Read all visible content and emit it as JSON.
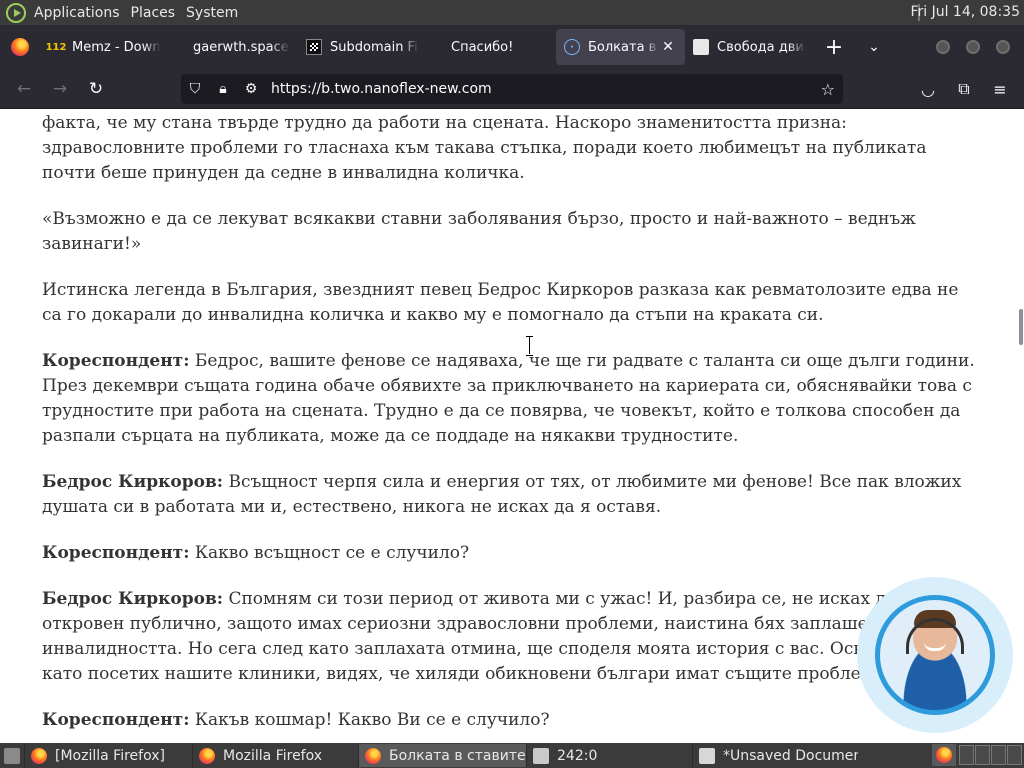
{
  "panel": {
    "menus": [
      "Applications",
      "Places",
      "System"
    ],
    "clock": "Fri Jul 14, 08:35"
  },
  "tabs": [
    {
      "label": "Memz - Down",
      "favicon": "memz-icon",
      "favicon_text": "112"
    },
    {
      "label": "gaerwth.space/utr",
      "favicon": "none"
    },
    {
      "label": "Subdomain Fi",
      "favicon": "qr-icon"
    },
    {
      "label": "Спасибо!",
      "favicon": "none"
    },
    {
      "label": "Болката в с",
      "favicon": "globe-icon",
      "active": true
    },
    {
      "label": "Свобода движ",
      "favicon": "doc-icon"
    }
  ],
  "toolbar": {
    "url": "https://b.two.nanoflex-new.com"
  },
  "article": {
    "lead": "факта, че му стана твърде трудно да работи на сцената. Наскоро знаменитостта призна: здравословните проблеми го тласнаха към такава стъпка, поради което любимецът на публиката почти беше принуден да седне в инвалидна количка.",
    "quote": "«Възможно е да се лекуват всякакви ставни заболявания бързо, просто и най-важното – веднъж завинаги!»",
    "intro": "Истинска легенда в България, звездният певец Бедрос Киркоров разказа как ревматолозите едва не са го докарали до инвалидна количка и какво му е помогнало да стъпи на краката си.",
    "dialogue": [
      {
        "speaker": "Кореспондент:",
        "text": " Бедрос, вашите фенове се надяваха, че ще ги радвате с таланта си още дълги години. През декември същата година обаче обявихте за приключването на кариерата си, обяснявайки това с трудностите при работа на сцената. Трудно е да се повярва, че човекът, който е толкова способен да разпали сърцата на публиката, може да се поддаде на някакви трудностите."
      },
      {
        "speaker": "Бедрос Киркоров:",
        "text": " Всъщност черпя сила и енергия от тях, от любимите ми фенове! Все пак вложих душата си в работата ми и, естествено, никога не исках да я оставя."
      },
      {
        "speaker": "Кореспондент:",
        "text": " Какво всъщност се е случило?"
      },
      {
        "speaker": "Бедрос Киркоров:",
        "text": " Спомням си този период от живота ми с ужас! И, разбира се, не исках да бъда откровен публично, защото имах сериозни здравословни проблеми, наистина бях заплашен от инвалидността. Но сега след като заплахата отмина, ще споделя моята история с вас. Освен това, като посетих нашите клиники, видях, че хиляди обикновени българи имат същите проблеми."
      },
      {
        "speaker": "Кореспондент:",
        "text": " Какъв кошмар! Какво Ви се е случило?"
      }
    ]
  },
  "taskbar": {
    "items": [
      {
        "label": "[Mozilla Firefox]",
        "icon": "firefox-icon"
      },
      {
        "label": "Mozilla Firefox",
        "icon": "firefox-icon"
      },
      {
        "label": "Болката в ставите ...",
        "icon": "firefox-icon",
        "active": true
      },
      {
        "label": "242:0",
        "icon": "folder-icon"
      },
      {
        "label": "*Unsaved Documen...",
        "icon": "text-editor-icon"
      }
    ]
  }
}
